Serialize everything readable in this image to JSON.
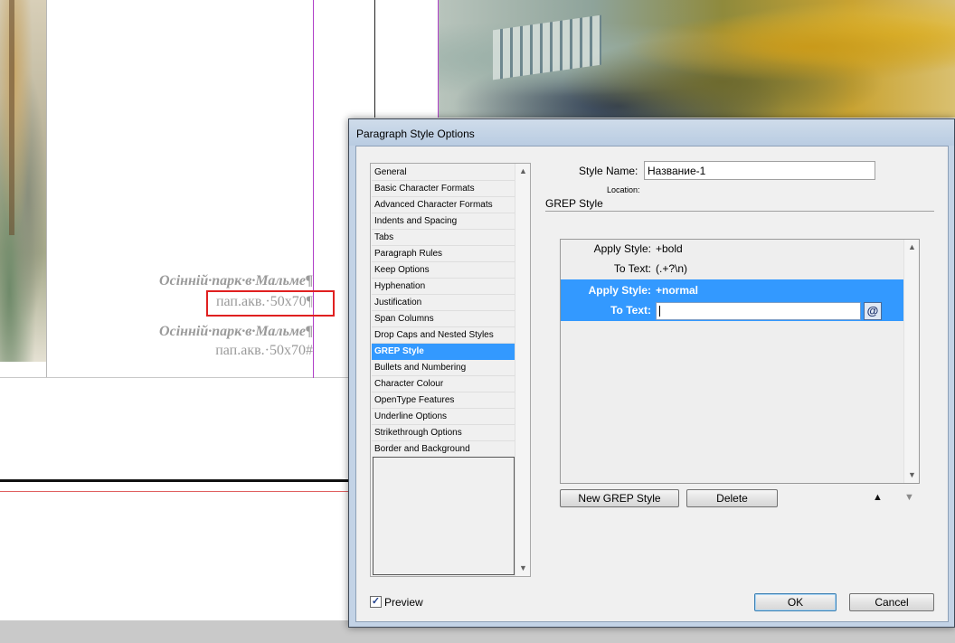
{
  "document": {
    "captions": [
      {
        "title": "Осінній·парк·в·Мальме",
        "title_end_mark": "¶",
        "subtitle": "пап.акв.·50х70",
        "subtitle_end_mark": "¶"
      },
      {
        "title": "Осінній·парк·в·Мальме",
        "title_end_mark": "¶",
        "subtitle": "пап.акв.·50х70",
        "subtitle_end_mark": "#"
      }
    ]
  },
  "dialog": {
    "title": "Paragraph Style Options",
    "nav": {
      "items": [
        "General",
        "Basic Character Formats",
        "Advanced Character Formats",
        "Indents and Spacing",
        "Tabs",
        "Paragraph Rules",
        "Keep Options",
        "Hyphenation",
        "Justification",
        "Span Columns",
        "Drop Caps and Nested Styles",
        "GREP Style",
        "Bullets and Numbering",
        "Character Colour",
        "OpenType Features",
        "Underline Options",
        "Strikethrough Options",
        "Border and Background"
      ],
      "selected": "GREP Style"
    },
    "style_name": {
      "label": "Style Name:",
      "value": "Название-1"
    },
    "location_label": "Location:",
    "section_title": "GREP Style",
    "grep_rules": [
      {
        "apply_label": "Apply Style:",
        "apply_value": "+bold",
        "text_label": "To Text:",
        "text_value": "(.+?\\n)",
        "selected": false
      },
      {
        "apply_label": "Apply Style:",
        "apply_value": "+normal",
        "text_label": "To Text:",
        "text_value": "",
        "selected": true
      }
    ],
    "special_char_button": "@",
    "buttons": {
      "new_grep_style": "New GREP Style",
      "delete": "Delete",
      "move_up": "▲",
      "move_down": "▼",
      "ok": "OK",
      "cancel": "Cancel"
    },
    "preview": {
      "label": "Preview",
      "checked": true,
      "check_glyph": "✓"
    }
  },
  "colors": {
    "selection": "#3399ff",
    "caption_text": "#9a9a9a",
    "highlight_box": "#e02020"
  }
}
